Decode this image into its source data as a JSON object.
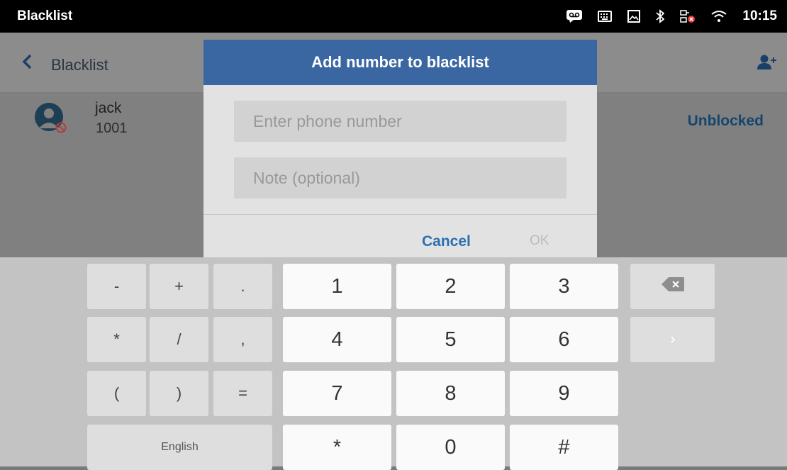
{
  "status_bar": {
    "app_title": "Blacklist",
    "time": "10:15",
    "icons": [
      "voicemail-icon",
      "keyboard-icon",
      "image-icon",
      "bluetooth-icon",
      "network-error-icon",
      "wifi-icon"
    ]
  },
  "app_bar": {
    "back_label": "Blacklist",
    "add_contact_icon": "add-contact-icon"
  },
  "contact": {
    "name": "jack",
    "number": "1001",
    "action": "Unblocked"
  },
  "dialog": {
    "title": "Add number to blacklist",
    "phone_placeholder": "Enter phone number",
    "note_placeholder": "Note (optional)",
    "cancel": "Cancel",
    "ok": "OK"
  },
  "keyboard": {
    "symbol_keys": [
      "-",
      "+",
      ".",
      "*",
      "/",
      ",",
      "(",
      ")",
      "="
    ],
    "digit_keys": [
      "1",
      "2",
      "3",
      "4",
      "5",
      "6",
      "7",
      "8",
      "9",
      "*",
      "0",
      "#"
    ],
    "language": "English",
    "backspace_icon": "backspace-icon",
    "next_icon": "chevron-right-icon"
  },
  "colors": {
    "dialog_header": "#3a67a2",
    "accent": "#2b6fb2",
    "status_bar": "#000000"
  }
}
